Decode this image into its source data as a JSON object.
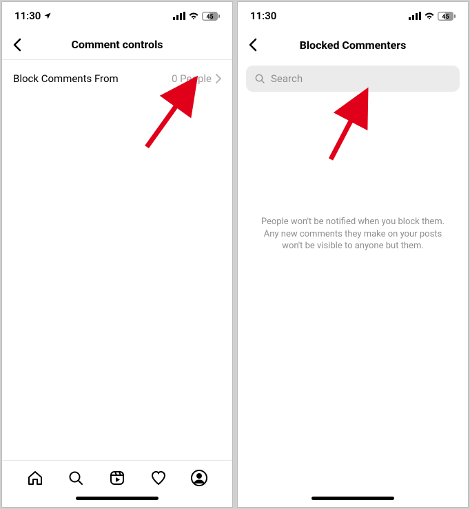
{
  "status": {
    "time": "11:30",
    "battery": "45"
  },
  "screen_left": {
    "title": "Comment controls",
    "row_label": "Block Comments From",
    "row_value": "0 People"
  },
  "screen_right": {
    "title": "Blocked Commenters",
    "search_placeholder": "Search",
    "info": "People won't be notified when you block them. Any new comments they make on your posts won't be visible to anyone but them."
  }
}
